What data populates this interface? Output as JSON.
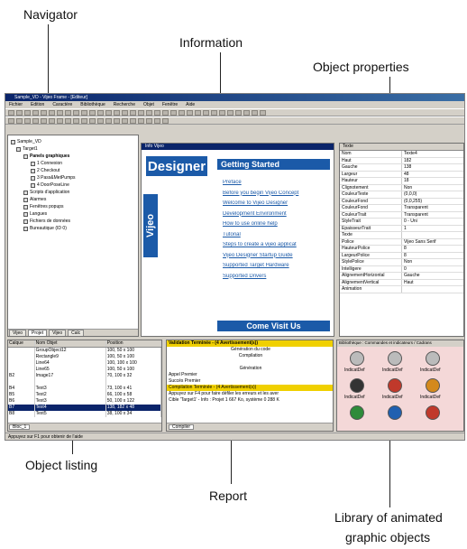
{
  "callouts": {
    "navigator": "Navigator",
    "information": "Information",
    "object_properties": "Object properties",
    "object_listing": "Object listing",
    "report": "Report",
    "library_line1": "Library of animated",
    "library_line2": "graphic objects"
  },
  "app": {
    "title": "Sample_VD - Vijeo Frame - [Editeur]",
    "menu": [
      "Fichier",
      "Edition",
      "Caractère",
      "Bibliothèque",
      "Recherche",
      "Objet",
      "Fenêtre",
      "Aide"
    ],
    "status": "Appuyez sur F1 pour obtenir de l'aide"
  },
  "navigator": {
    "items": [
      "Sample_VD",
      "Target1",
      "Panels graphiques",
      "1 Connexion",
      "2 Checkout",
      "3 Pass&MetPumps",
      "4 DoorPoseLine",
      "Scripts d'application",
      "Alarmes",
      "Fenêtres popups",
      "Langues",
      "Fichiers de données",
      "Bureautique (ID 0)"
    ],
    "tabs": [
      "Vijeo",
      "Projet",
      "Vijeo",
      "Calc"
    ]
  },
  "info": {
    "title": "Info Vijeo",
    "logo_top": "Designer",
    "logo_side": "Vijeo",
    "heading": "Getting Started",
    "links": [
      "Preface",
      "Before you begin Vijeo Concept",
      "Welcome to Vijeo Designer",
      "Development Environment",
      "How to use online help",
      "Tutorial",
      "Steps to create a vijeo applicat",
      "Vijeo Designer Startup Guide",
      "Supported Target Hardware",
      "Supported Drivers"
    ],
    "footer": "Come Visit Us"
  },
  "properties": {
    "header": "Texte",
    "rows": [
      [
        "Nom",
        "Texte4"
      ],
      [
        "Haut",
        "182"
      ],
      [
        "Gauche",
        "138"
      ],
      [
        "Largeur",
        "48"
      ],
      [
        "Hauteur",
        "18"
      ],
      [
        "Clignotement",
        "Non"
      ],
      [
        "CouleurTexte",
        "(0,0,0)"
      ],
      [
        "CouleurFond",
        "(0,0,255)"
      ],
      [
        "CouleurFond",
        "Transparent"
      ],
      [
        "CouleurTrait",
        "Transparent"
      ],
      [
        "StyleTrait",
        "0 - Uni"
      ],
      [
        "EpaisseurTrait",
        "1"
      ],
      [
        "Texte",
        ""
      ],
      [
        "Police",
        "Vijeo Sans Serif"
      ],
      [
        "HauteurPolice",
        "8"
      ],
      [
        "LargeurPolice",
        "8"
      ],
      [
        "StylePolice",
        "Non"
      ],
      [
        "Intelligere",
        "0"
      ],
      [
        "AlignementHorizontal",
        "Gauche"
      ],
      [
        "AlignementVertical",
        "Haut"
      ],
      [
        "Animation",
        ""
      ]
    ]
  },
  "listing": {
    "columns": [
      "Calque",
      "Nom Objet",
      "Position"
    ],
    "rows": [
      [
        "",
        "GroupObject12",
        "100, 50 x 100"
      ],
      [
        "",
        "Rectangle9",
        "100, 50 x 100"
      ],
      [
        "",
        "Line64",
        "100, 100 x 100"
      ],
      [
        "",
        "Line65",
        "100, 50 x 100"
      ],
      [
        "B2",
        "Image17",
        "70, 100 x 32"
      ],
      [
        "",
        "",
        ""
      ],
      [
        "B4",
        "Text3",
        "73, 100 x 41"
      ],
      [
        "B5",
        "Text2",
        "66, 100 x 58"
      ],
      [
        "B6",
        "Text3",
        "50, 100 x 122"
      ],
      [
        "B7",
        "Text4",
        "138, 182 x 48"
      ],
      [
        "B8",
        "Text5",
        "38, 100 x 34"
      ]
    ],
    "tab": "Bloc_1"
  },
  "report": {
    "lines": [
      "Validation Terminée - (4 Avertissement(s))",
      "Génération du code",
      "Compilation",
      "",
      "Génération",
      "Appel Premier",
      "Succès Premier",
      "Compilation Terminée - (4 Avertissement(s))",
      "Appuyez sur F4 pour faire défiler les erreurs et les aver",
      "Cible 'Target1' - Info : Projet 1 667 Ko, système 0 288 K"
    ],
    "tab": "Compiler"
  },
  "library": {
    "title": "Bibliothèque : Commandes et indicateurs / Cadrans",
    "label": "IndicatDef"
  },
  "colors": {
    "accent": "#0a246a",
    "info_blue": "#1b5aa8",
    "library_bg": "#f4d8d8"
  }
}
